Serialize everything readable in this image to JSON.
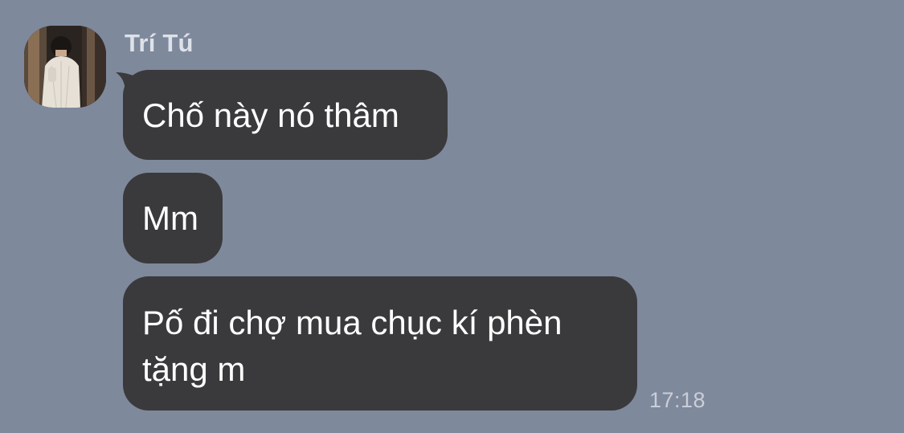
{
  "conversation": {
    "sender": {
      "name": "Trí Tú"
    },
    "messages": [
      {
        "text": "Chố này nó thâm"
      },
      {
        "text": "Mm"
      },
      {
        "text": "Pố đi chợ mua chục kí phèn tặng m"
      }
    ],
    "last_timestamp": "17:18"
  }
}
